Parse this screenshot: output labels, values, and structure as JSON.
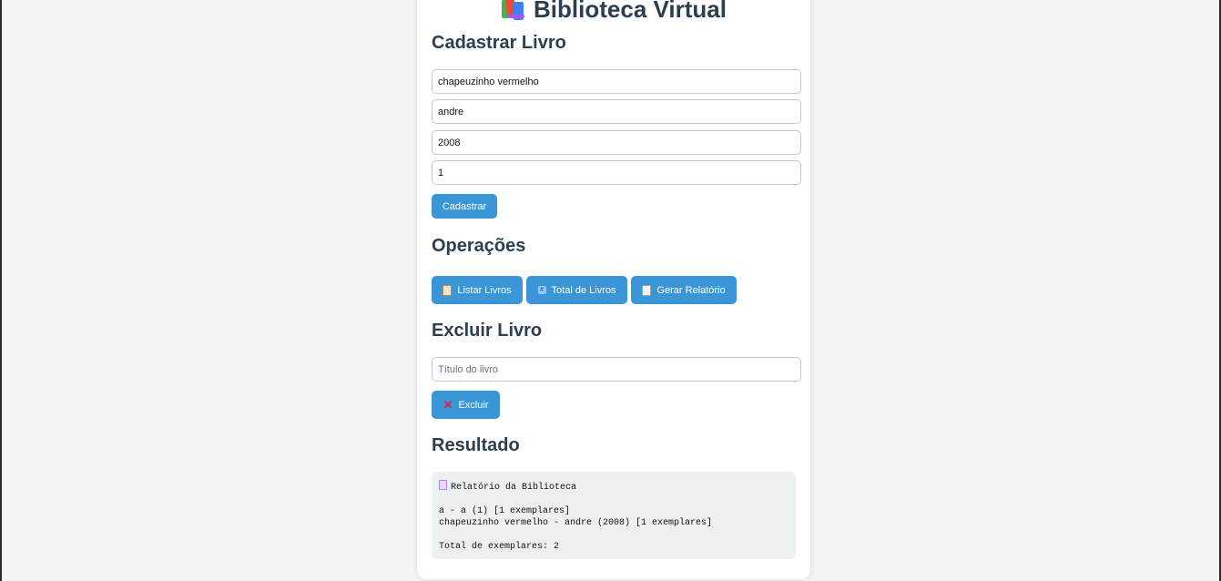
{
  "header": {
    "title": "Biblioteca Virtual",
    "icon": "books-icon"
  },
  "cadastrar": {
    "heading": "Cadastrar Livro",
    "fields": [
      {
        "value": "chapeuzinho vermelho"
      },
      {
        "value": "andre"
      },
      {
        "value": "2008"
      },
      {
        "value": "1"
      }
    ],
    "submit_label": "Cadastrar"
  },
  "operacoes": {
    "heading": "Operações",
    "buttons": [
      {
        "label": "Listar Livros",
        "icon": "clipboard-icon"
      },
      {
        "label": "Total de Livros",
        "icon": "numbers-icon"
      },
      {
        "label": "Gerar Relatório",
        "icon": "document-icon"
      }
    ]
  },
  "excluir": {
    "heading": "Excluir Livro",
    "placeholder": "Título do livro",
    "button_label": "Excluir",
    "button_icon": "cross-icon"
  },
  "resultado": {
    "heading": "Resultado",
    "report_title": "Relatório da Biblioteca",
    "lines": [
      "a - a (1) [1 exemplares]",
      "chapeuzinho vermelho - andre (2008) [1 exemplares]"
    ],
    "total": "Total de exemplares: 2"
  },
  "colors": {
    "accent": "#3a96d6",
    "heading": "#2c3e50",
    "background": "#f3f4f6",
    "result_bg": "#ecf0f1"
  }
}
